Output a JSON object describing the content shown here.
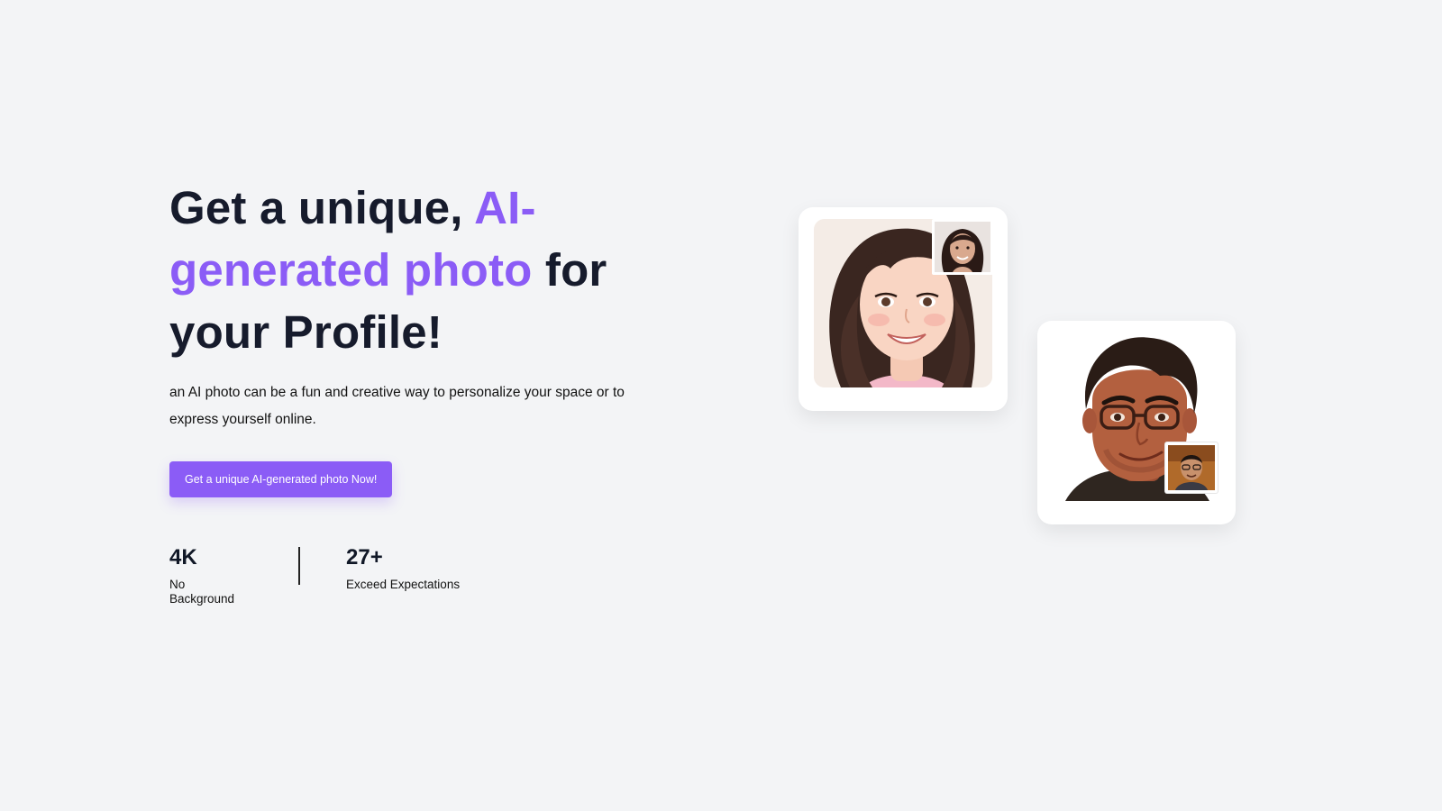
{
  "hero": {
    "headline_part1": "Get a unique, ",
    "headline_accent": "AI-generated photo",
    "headline_part2": " for your Profile!",
    "subtitle": "an AI photo can be a fun and creative way to personalize your space or to express yourself online.",
    "cta_label": "Get a unique AI-generated photo Now!"
  },
  "stats": [
    {
      "value": "4K",
      "label": "No Background"
    },
    {
      "value": "27+",
      "label": "Exceed Expectations"
    }
  ],
  "colors": {
    "background": "#f3f4f6",
    "accent": "#8b5cf6",
    "heading": "#161b2c",
    "card": "#ffffff"
  },
  "images": {
    "card1_main": "ai-portrait-woman",
    "card1_thumb": "original-photo-woman",
    "card2_main": "ai-portrait-man-glasses",
    "card2_thumb": "original-photo-man"
  }
}
